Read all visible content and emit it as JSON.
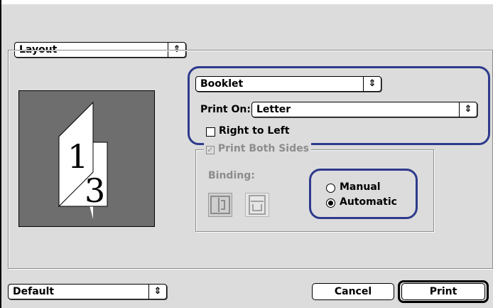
{
  "layout_popup": {
    "value": "Layout"
  },
  "booklet_popup": {
    "value": "Booklet"
  },
  "print_on": {
    "label": "Print On:",
    "value": "Letter"
  },
  "right_to_left": {
    "label": "Right to Left",
    "checked": false
  },
  "print_both_sides": {
    "label": "Print Both Sides",
    "checked": true,
    "enabled": false
  },
  "binding": {
    "label": "Binding:"
  },
  "duplex_mode": {
    "manual_label": "Manual",
    "automatic_label": "Automatic",
    "selected": "Automatic"
  },
  "preview": {
    "page_front": "1",
    "page_back": "3"
  },
  "presets_popup": {
    "value": "Default"
  },
  "buttons": {
    "cancel": "Cancel",
    "print": "Print"
  },
  "colors": {
    "highlight": "#2e3a8c",
    "dialog_bg": "#dcdcdc",
    "preview_bg": "#6e6e6e",
    "disabled_text": "#8c8c8c"
  }
}
